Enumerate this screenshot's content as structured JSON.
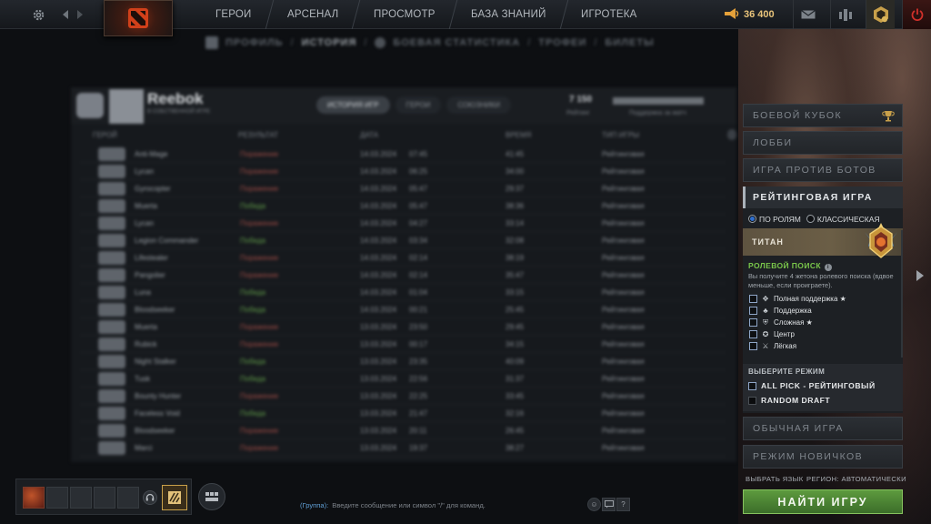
{
  "topbar": {
    "nav": [
      "ГЕРОИ",
      "АРСЕНАЛ",
      "ПРОСМОТР",
      "БАЗА ЗНАНИЙ",
      "ИГРОТЕКА"
    ],
    "shards": "36 400"
  },
  "subnav": {
    "items": [
      "ПРОФИЛЬ",
      "ИСТОРИЯ",
      "БОЕВАЯ СТАТИСТИКА",
      "ТРОФЕИ",
      "БИЛЕТЫ"
    ]
  },
  "history": {
    "player_name": "Reebok",
    "player_sub": "В СОБСТВЕННОЙ ИГРЕ",
    "tabs": [
      "ИСТОРИЯ ИГР",
      "ГЕРОИ",
      "СОЮЗНИКИ"
    ],
    "stat_value": "7 150",
    "stat_label": "Рейтинг",
    "bar_label": "Поддержка за матч",
    "columns": [
      "ГЕРОЙ",
      "РЕЗУЛЬТАТ",
      "ДАТА",
      "ВРЕМЯ",
      "ТИП ИГРЫ"
    ],
    "rows": [
      {
        "hero": "Anti-Mage",
        "result": "Поражение",
        "date": "14.03.2024",
        "time": "07:45",
        "dur": "41:45",
        "type": "Рейтинговая"
      },
      {
        "hero": "Lycan",
        "result": "Поражение",
        "date": "14.03.2024",
        "time": "06:25",
        "dur": "34:00",
        "type": "Рейтинговая"
      },
      {
        "hero": "Gyrocopter",
        "result": "Поражение",
        "date": "14.03.2024",
        "time": "05:47",
        "dur": "29:37",
        "type": "Рейтинговая"
      },
      {
        "hero": "Muerta",
        "result": "Победа",
        "date": "14.03.2024",
        "time": "05:47",
        "dur": "38:36",
        "type": "Рейтинговая"
      },
      {
        "hero": "Lycan",
        "result": "Поражение",
        "date": "14.03.2024",
        "time": "04:27",
        "dur": "33:14",
        "type": "Рейтинговая"
      },
      {
        "hero": "Legion Commander",
        "result": "Победа",
        "date": "14.03.2024",
        "time": "03:34",
        "dur": "32:08",
        "type": "Рейтинговая"
      },
      {
        "hero": "Lifestealer",
        "result": "Поражение",
        "date": "14.03.2024",
        "time": "02:14",
        "dur": "38:19",
        "type": "Рейтинговая"
      },
      {
        "hero": "Pangolier",
        "result": "Поражение",
        "date": "14.03.2024",
        "time": "02:14",
        "dur": "35:47",
        "type": "Рейтинговая"
      },
      {
        "hero": "Luna",
        "result": "Победа",
        "date": "14.03.2024",
        "time": "01:04",
        "dur": "33:15",
        "type": "Рейтинговая"
      },
      {
        "hero": "Bloodseeker",
        "result": "Победа",
        "date": "14.03.2024",
        "time": "00:21",
        "dur": "25:45",
        "type": "Рейтинговая"
      },
      {
        "hero": "Muerta",
        "result": "Поражение",
        "date": "13.03.2024",
        "time": "23:50",
        "dur": "29:45",
        "type": "Рейтинговая"
      },
      {
        "hero": "Rubick",
        "result": "Поражение",
        "date": "13.03.2024",
        "time": "00:17",
        "dur": "34:15",
        "type": "Рейтинговая"
      },
      {
        "hero": "Night Stalker",
        "result": "Победа",
        "date": "13.03.2024",
        "time": "23:35",
        "dur": "40:09",
        "type": "Рейтинговая"
      },
      {
        "hero": "Tusk",
        "result": "Победа",
        "date": "13.03.2024",
        "time": "22:56",
        "dur": "31:37",
        "type": "Рейтинговая"
      },
      {
        "hero": "Bounty Hunter",
        "result": "Поражение",
        "date": "13.03.2024",
        "time": "22:25",
        "dur": "33:45",
        "type": "Рейтинговая"
      },
      {
        "hero": "Faceless Void",
        "result": "Победа",
        "date": "13.03.2024",
        "time": "21:47",
        "dur": "32:16",
        "type": "Рейтинговая"
      },
      {
        "hero": "Bloodseeker",
        "result": "Поражение",
        "date": "13.03.2024",
        "time": "20:11",
        "dur": "26:45",
        "type": "Рейтинговая"
      },
      {
        "hero": "Marci",
        "result": "Поражение",
        "date": "13.03.2024",
        "time": "19:37",
        "dur": "38:27",
        "type": "Рейтинговая"
      }
    ]
  },
  "play": {
    "modes_top": [
      "БОЕВОЙ КУБОК",
      "ЛОББИ",
      "ИГРА ПРОТИВ БОТОВ"
    ],
    "ranked_title": "РЕЙТИНГОВАЯ ИГРА",
    "radio_roles": "ПО РОЛЯМ",
    "radio_classic": "КЛАССИЧЕСКАЯ",
    "rank_name": "ТИТАН",
    "role_search_title": "РОЛЕВОЙ ПОИСК",
    "role_search_desc": "Вы получите 4 жетона ролевого поиска (вдвое меньше, если проиграете).",
    "roles": [
      {
        "label": "Полная поддержка ★",
        "icon": "hard-support-icon",
        "glyph": "✥"
      },
      {
        "label": "Поддержка",
        "icon": "support-icon",
        "glyph": "♣"
      },
      {
        "label": "Сложная ★",
        "icon": "offlane-icon",
        "glyph": "⛨"
      },
      {
        "label": "Центр",
        "icon": "mid-icon",
        "glyph": "✪"
      },
      {
        "label": "Лёгкая",
        "icon": "carry-icon",
        "glyph": "⚔"
      }
    ],
    "select_mode_label": "ВЫБЕРИТЕ РЕЖИМ",
    "game_modes": [
      "ALL PICK - РЕЙТИНГОВЫЙ",
      "RANDOM DRAFT"
    ],
    "modes_bottom": [
      "ОБЫЧНАЯ ИГРА",
      "РЕЖИМ НОВИЧКОВ"
    ],
    "language_label": "ВЫБРАТЬ ЯЗЫК",
    "region_label": "РЕГИОН: АВТОМАТИЧЕСКИ",
    "find_game": "НАЙТИ ИГРУ"
  },
  "chat": {
    "channel": "(Группа):",
    "placeholder": "Введите сообщение или символ \"/\" для команд."
  },
  "colors": {
    "find_game": "#4f8a35",
    "role_title": "#79c64a",
    "titan_band": "#6b5e46"
  }
}
